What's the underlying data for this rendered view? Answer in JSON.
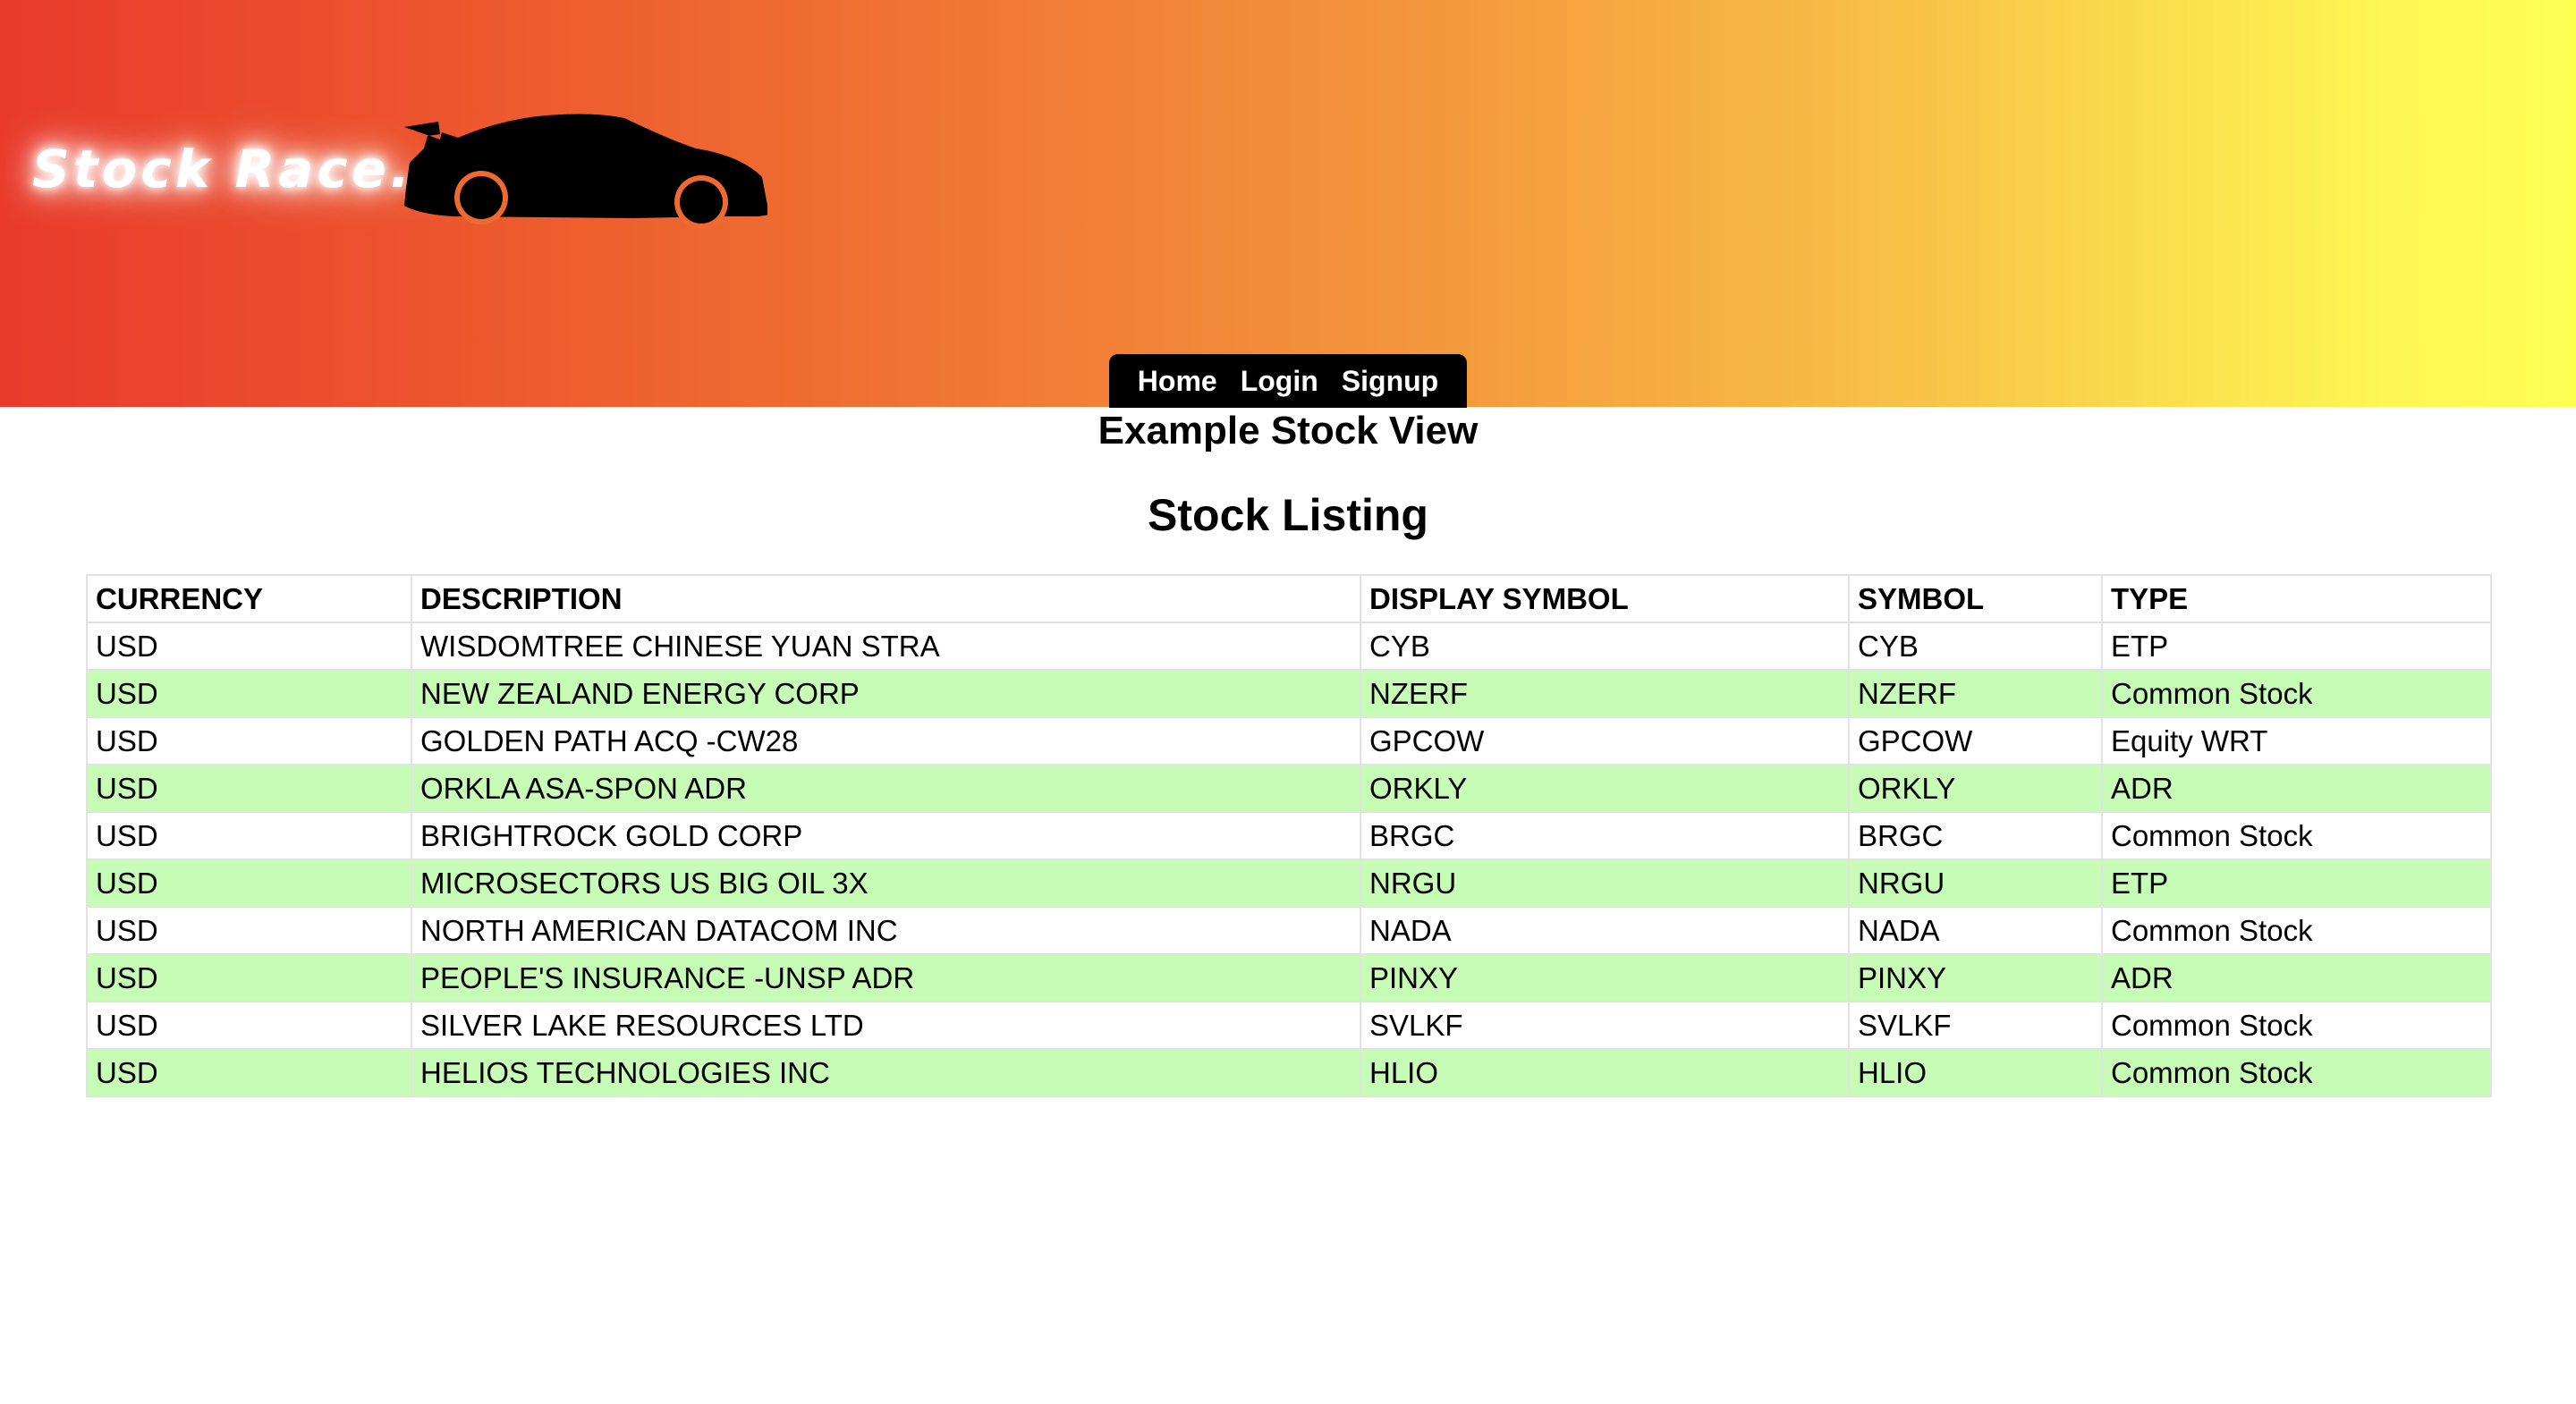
{
  "header": {
    "logo_text": "Stock Race...",
    "brand_colors": {
      "gradient_start": "#e93a2b",
      "gradient_end": "#ffff52"
    },
    "car_icon": "race-car-silhouette"
  },
  "nav": {
    "items": [
      {
        "label": "Home"
      },
      {
        "label": "Login"
      },
      {
        "label": "Signup"
      }
    ]
  },
  "main": {
    "page_title": "Example Stock View",
    "section_title": "Stock Listing"
  },
  "table": {
    "columns": [
      "CURRENCY",
      "DESCRIPTION",
      "DISPLAY SYMBOL",
      "SYMBOL",
      "TYPE"
    ],
    "alt_row_color": "#c6fcb6",
    "rows": [
      {
        "currency": "USD",
        "description": "WISDOMTREE CHINESE YUAN STRA",
        "display_symbol": "CYB",
        "symbol": "CYB",
        "type": "ETP"
      },
      {
        "currency": "USD",
        "description": "NEW ZEALAND ENERGY CORP",
        "display_symbol": "NZERF",
        "symbol": "NZERF",
        "type": "Common Stock"
      },
      {
        "currency": "USD",
        "description": "GOLDEN PATH ACQ -CW28",
        "display_symbol": "GPCOW",
        "symbol": "GPCOW",
        "type": "Equity WRT"
      },
      {
        "currency": "USD",
        "description": "ORKLA ASA-SPON ADR",
        "display_symbol": "ORKLY",
        "symbol": "ORKLY",
        "type": "ADR"
      },
      {
        "currency": "USD",
        "description": "BRIGHTROCK GOLD CORP",
        "display_symbol": "BRGC",
        "symbol": "BRGC",
        "type": "Common Stock"
      },
      {
        "currency": "USD",
        "description": "MICROSECTORS US BIG OIL 3X",
        "display_symbol": "NRGU",
        "symbol": "NRGU",
        "type": "ETP"
      },
      {
        "currency": "USD",
        "description": "NORTH AMERICAN DATACOM INC",
        "display_symbol": "NADA",
        "symbol": "NADA",
        "type": "Common Stock"
      },
      {
        "currency": "USD",
        "description": "PEOPLE'S INSURANCE -UNSP ADR",
        "display_symbol": "PINXY",
        "symbol": "PINXY",
        "type": "ADR"
      },
      {
        "currency": "USD",
        "description": "SILVER LAKE RESOURCES LTD",
        "display_symbol": "SVLKF",
        "symbol": "SVLKF",
        "type": "Common Stock"
      },
      {
        "currency": "USD",
        "description": "HELIOS TECHNOLOGIES INC",
        "display_symbol": "HLIO",
        "symbol": "HLIO",
        "type": "Common Stock"
      }
    ]
  }
}
